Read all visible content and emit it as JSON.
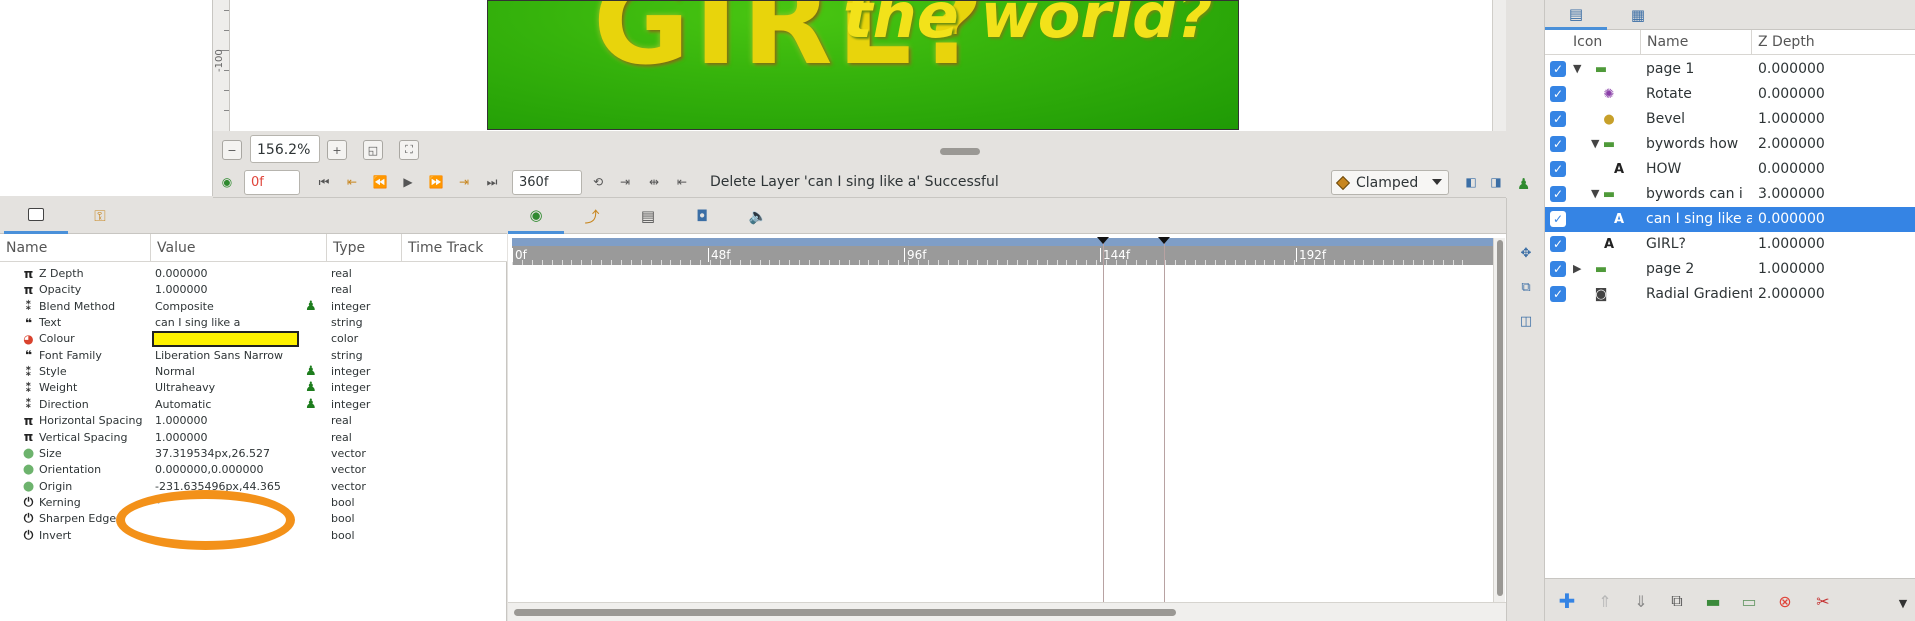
{
  "canvas": {
    "ruler_label": "-100",
    "text_main": "GIRL?",
    "text_overlay": "the world?"
  },
  "zoom": {
    "value": "156.2%"
  },
  "timebar": {
    "current_time": "0f",
    "end_time": "360f",
    "status": "Delete Layer 'can I sing like a' Successful",
    "interpolation": "Clamped"
  },
  "params": {
    "headers": {
      "name": "Name",
      "value": "Value",
      "type": "Type",
      "timetrack": "Time Track"
    },
    "rows": [
      {
        "icon": "pi-icon",
        "glyph": "π",
        "name": "Z Depth",
        "value": "0.000000",
        "type": "real",
        "static": false
      },
      {
        "icon": "pi-icon",
        "glyph": "π",
        "name": "Opacity",
        "value": "1.000000",
        "type": "real",
        "static": false
      },
      {
        "icon": "integer-icon",
        "glyph": "⁑",
        "name": "Blend Method",
        "value": "Composite",
        "type": "integer",
        "static": true
      },
      {
        "icon": "quote-icon",
        "glyph": "❝",
        "name": "Text",
        "value": "can I sing like a",
        "type": "string",
        "static": false
      },
      {
        "icon": "color-wheel-icon",
        "glyph": "◕",
        "name": "Colour",
        "value": "",
        "type": "color",
        "static": false
      },
      {
        "icon": "quote-icon",
        "glyph": "❝",
        "name": "Font Family",
        "value": "Liberation Sans Narrow",
        "type": "string",
        "static": false
      },
      {
        "icon": "integer-icon",
        "glyph": "⁑",
        "name": "Style",
        "value": "Normal",
        "type": "integer",
        "static": true
      },
      {
        "icon": "integer-icon",
        "glyph": "⁑",
        "name": "Weight",
        "value": "Ultraheavy",
        "type": "integer",
        "static": true
      },
      {
        "icon": "integer-icon",
        "glyph": "⁑",
        "name": "Direction",
        "value": "Automatic",
        "type": "integer",
        "static": true
      },
      {
        "icon": "pi-icon",
        "glyph": "π",
        "name": "Horizontal Spacing",
        "value": "1.000000",
        "type": "real",
        "static": false
      },
      {
        "icon": "pi-icon",
        "glyph": "π",
        "name": "Vertical Spacing",
        "value": "1.000000",
        "type": "real",
        "static": false
      },
      {
        "icon": "vector-icon",
        "glyph": "●",
        "name": "Size",
        "value": "37.319534px,26.527",
        "type": "vector",
        "static": false
      },
      {
        "icon": "vector-icon",
        "glyph": "●",
        "name": "Orientation",
        "value": "0.000000,0.000000",
        "type": "vector",
        "static": false
      },
      {
        "icon": "vector-icon",
        "glyph": "●",
        "name": "Origin",
        "value": "-231.635496px,44.365",
        "type": "vector",
        "static": false
      },
      {
        "icon": "power-icon",
        "glyph": "⏻",
        "name": "Kerning",
        "value": "✓",
        "type": "bool",
        "static": false
      },
      {
        "icon": "power-icon",
        "glyph": "⏻",
        "name": "Sharpen Edges",
        "value": "",
        "type": "bool",
        "static": false
      },
      {
        "icon": "power-icon",
        "glyph": "⏻",
        "name": "Invert",
        "value": "",
        "type": "bool",
        "static": false
      }
    ],
    "colour_hex": "#fff200"
  },
  "timetrack": {
    "labels": [
      "0f",
      "48f",
      "96f",
      "144f",
      "192f"
    ]
  },
  "layers": {
    "headers": {
      "icon": "Icon",
      "name": "Name",
      "zdepth": "Z Depth"
    },
    "rows": [
      {
        "name": "page 1",
        "z": "0.000000",
        "icon": "folder-icon",
        "expander": "▼",
        "indent": 0,
        "selected": false
      },
      {
        "name": "Rotate",
        "z": "0.000000",
        "icon": "rotate-icon",
        "expander": "",
        "indent": 1,
        "selected": false
      },
      {
        "name": "Bevel",
        "z": "1.000000",
        "icon": "bevel-icon",
        "expander": "",
        "indent": 1,
        "selected": false
      },
      {
        "name": "bywords how",
        "z": "2.000000",
        "icon": "folder-icon",
        "expander": "▼",
        "indent": 1,
        "selected": false
      },
      {
        "name": "HOW",
        "z": "0.000000",
        "icon": "text-layer-icon",
        "expander": "",
        "indent": 2,
        "selected": false
      },
      {
        "name": "bywords can i",
        "z": "3.000000",
        "icon": "folder-icon",
        "expander": "▼",
        "indent": 1,
        "selected": false
      },
      {
        "name": "can I sing like a",
        "z": "0.000000",
        "icon": "text-layer-icon",
        "expander": "",
        "indent": 2,
        "selected": true
      },
      {
        "name": "GIRL?",
        "z": "1.000000",
        "icon": "text-layer-icon",
        "expander": "",
        "indent": 1,
        "selected": false
      },
      {
        "name": "page 2",
        "z": "1.000000",
        "icon": "folder-icon",
        "expander": "▶",
        "indent": 0,
        "selected": false
      },
      {
        "name": "Radial Gradient",
        "z": "2.000000",
        "icon": "gradient-icon",
        "expander": "",
        "indent": 0,
        "selected": false
      }
    ]
  }
}
